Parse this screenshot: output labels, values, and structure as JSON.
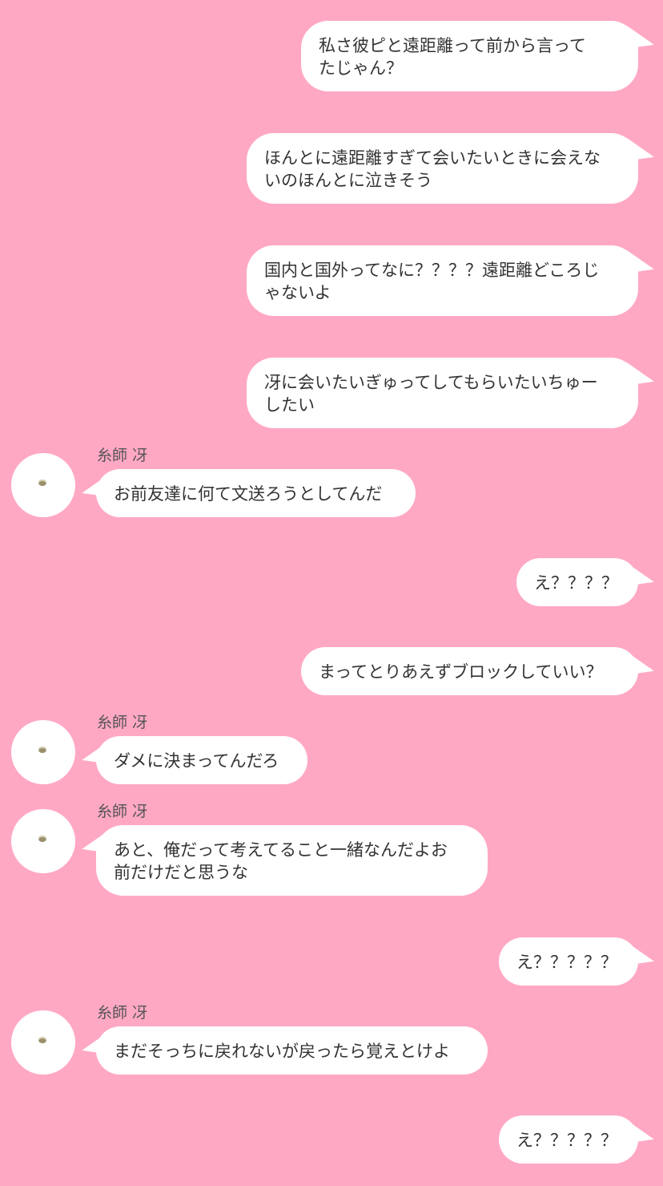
{
  "contact_name": "糸師 冴",
  "avatar_icon": "avatar-icon",
  "colors": {
    "background": "#FFA8C4",
    "bubble": "#FFFFFF",
    "text": "#333333"
  },
  "messages": [
    {
      "from": "me",
      "text": "私さ彼ピと遠距離って前から言って\nたじゃん？"
    },
    {
      "from": "me",
      "text": "ほんとに遠距離すぎて会いたいときに会えな\nいのほんとに泣きそう"
    },
    {
      "from": "me",
      "text": "国内と国外ってなに？？？？遠距離どころじ\nゃないよ"
    },
    {
      "from": "me",
      "text": "冴に会いたいぎゅってしてもらいたいちゅー\nしたい"
    },
    {
      "from": "them",
      "sender": "糸師 冴",
      "text": "お前友達に何て文送ろうとしてんだ"
    },
    {
      "from": "me",
      "text": "え？？？？"
    },
    {
      "from": "me",
      "text": "まってとりあえずブロックしていい？"
    },
    {
      "from": "them",
      "sender": "糸師 冴",
      "text": "ダメに決まってんだろ"
    },
    {
      "from": "them",
      "sender": "糸師 冴",
      "text": "あと、俺だって考えてること一緒なんだよお\n前だけだと思うな"
    },
    {
      "from": "me",
      "text": "え？？？？？"
    },
    {
      "from": "them",
      "sender": "糸師 冴",
      "text": "まだそっちに戻れないが戻ったら覚えとけよ"
    },
    {
      "from": "me",
      "text": "え？？？？？"
    }
  ]
}
